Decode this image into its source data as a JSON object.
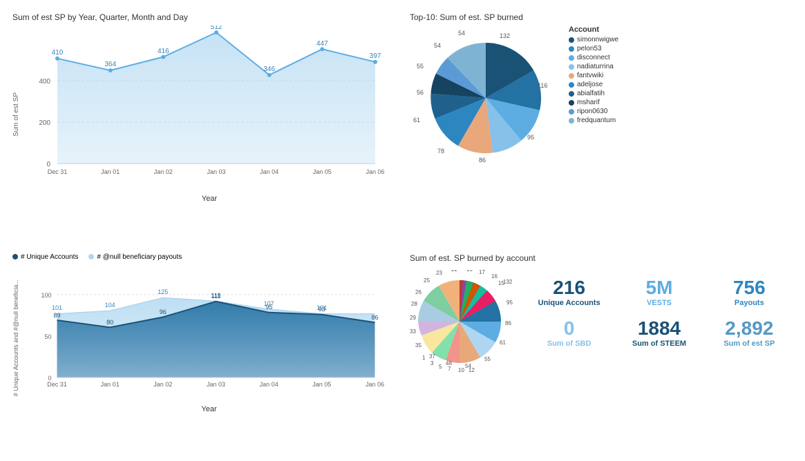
{
  "topLeft": {
    "title": "Sum of est SP by Year, Quarter, Month and Day",
    "yAxisLabel": "Sum of est SP",
    "xAxisLabel": "Year",
    "xLabels": [
      "Dec 31",
      "Jan 01",
      "Jan 02",
      "Jan 03",
      "Jan 04",
      "Jan 05",
      "Jan 06"
    ],
    "dataPoints": [
      410,
      364,
      416,
      512,
      346,
      447,
      397
    ],
    "yTicks": [
      0,
      200,
      400
    ]
  },
  "topRight": {
    "title": "Top-10: Sum of est. SP burned",
    "legendTitle": "Account",
    "pieLabels": [
      "54",
      "132",
      "54",
      "55",
      "56",
      "61",
      "78",
      "86",
      "95",
      "116"
    ],
    "legendItems": [
      {
        "label": "simonnwigwe",
        "color": "#1a5276"
      },
      {
        "label": "pelon53",
        "color": "#2e86c1"
      },
      {
        "label": "disconnect",
        "color": "#5dade2"
      },
      {
        "label": "nadiaturrina",
        "color": "#85c1e9"
      },
      {
        "label": "fantvwiki",
        "color": "#e67e22"
      },
      {
        "label": "adeljose",
        "color": "#2980b9"
      },
      {
        "label": "abialfatih",
        "color": "#1f618d"
      },
      {
        "label": "msharif",
        "color": "#154360"
      },
      {
        "label": "ripon0630",
        "color": "#2471a3"
      },
      {
        "label": "fredquantum",
        "color": "#7fb3d3"
      }
    ]
  },
  "bottomLeft": {
    "title": "",
    "legendItems": [
      {
        "label": "# Unique Accounts",
        "type": "dark"
      },
      {
        "label": "# @null beneficiary payouts",
        "type": "light"
      }
    ],
    "xAxisLabel": "Year",
    "xLabels": [
      "Dec 31",
      "Jan 01",
      "Jan 02",
      "Jan 03",
      "Jan 04",
      "Jan 05",
      "Jan 06"
    ],
    "darkData": [
      89,
      80,
      96,
      111,
      95,
      93,
      86
    ],
    "lightData": [
      101,
      104,
      125,
      118,
      107,
      101
    ],
    "yTicks": [
      0,
      50,
      100
    ],
    "darkLabels": [
      "89",
      "80",
      "96",
      "111",
      "95",
      "93",
      "86"
    ],
    "lightLabels": [
      "101",
      "104",
      "125",
      "118",
      "107",
      "101"
    ]
  },
  "bottomRight": {
    "title": "Sum of est. SP burned by account",
    "stats": [
      {
        "number": "216",
        "label": "Unique Accounts",
        "numClass": "blue-dark",
        "lblClass": "blue-dark"
      },
      {
        "number": "5M",
        "label": "VESTS",
        "numClass": "blue-mid",
        "lblClass": "blue-mid"
      },
      {
        "number": "756",
        "label": "Payouts",
        "numClass": "blue-bright",
        "lblClass": "blue-bright"
      }
    ],
    "stats2": [
      {
        "number": "0",
        "label": "Sum of SBD",
        "numClass": "gray",
        "lblClass": "gray"
      },
      {
        "number": "1884",
        "label": "Sum of STEEM",
        "numClass": "dark",
        "lblClass": "dark"
      },
      {
        "number": "2,892",
        "label": "Sum of est SP",
        "numClass": "teal",
        "lblClass": "teal"
      }
    ],
    "smallPieLabels": [
      "132",
      "95",
      "86",
      "61",
      "55",
      "54",
      "48",
      "37",
      "35",
      "33",
      "29",
      "28",
      "26",
      "25",
      "23",
      "22",
      "19",
      "17",
      "16",
      "15",
      "12",
      "10",
      "7",
      "5",
      "3",
      "1"
    ]
  }
}
